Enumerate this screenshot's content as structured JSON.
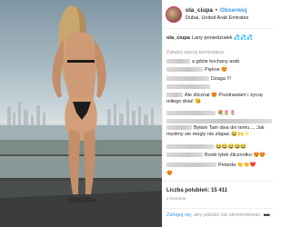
{
  "header": {
    "username": "ola_ciupa",
    "separator": "•",
    "follow_label": "Obserwuj",
    "location": "Dubai, United Arab Emirates"
  },
  "caption": {
    "username": "ola_ciupa",
    "text": "Lany poniedziałek 💦💦💦"
  },
  "load_more": "Załaduj więcej komentarzy",
  "comments": [
    {
      "text": "a gdzie kochany arab"
    },
    {
      "text": "Piękne 😍"
    },
    {
      "text": "Dżaga !!!"
    },
    {
      "text": ""
    },
    {
      "text": "Ale ślicznal 😍 Pozdrawiam i życzę miłego dnia! 😘"
    },
    {
      "text": "💐🌷🌷"
    },
    {
      "text": "Byłam Tam dwa dni temu.... Jak myslmy sie mogly nie zlapac 😂🙌✨"
    },
    {
      "text": "😂😂😂😂😂"
    },
    {
      "text": "Boski tyłek ślicznotko 😍😍"
    },
    {
      "text": "Petarda 👏👏❤️"
    },
    {
      "text": "😍"
    }
  ],
  "footer": {
    "likes": "Liczba polubień: 15 411",
    "time": "2 kwietnia",
    "login_prefix": "Zaloguj się",
    "login_suffix": ", aby polubić lub skomentować.",
    "more_icon": "•••"
  },
  "colors": {
    "link": "#3897f0",
    "muted": "#999999",
    "text": "#262626"
  }
}
